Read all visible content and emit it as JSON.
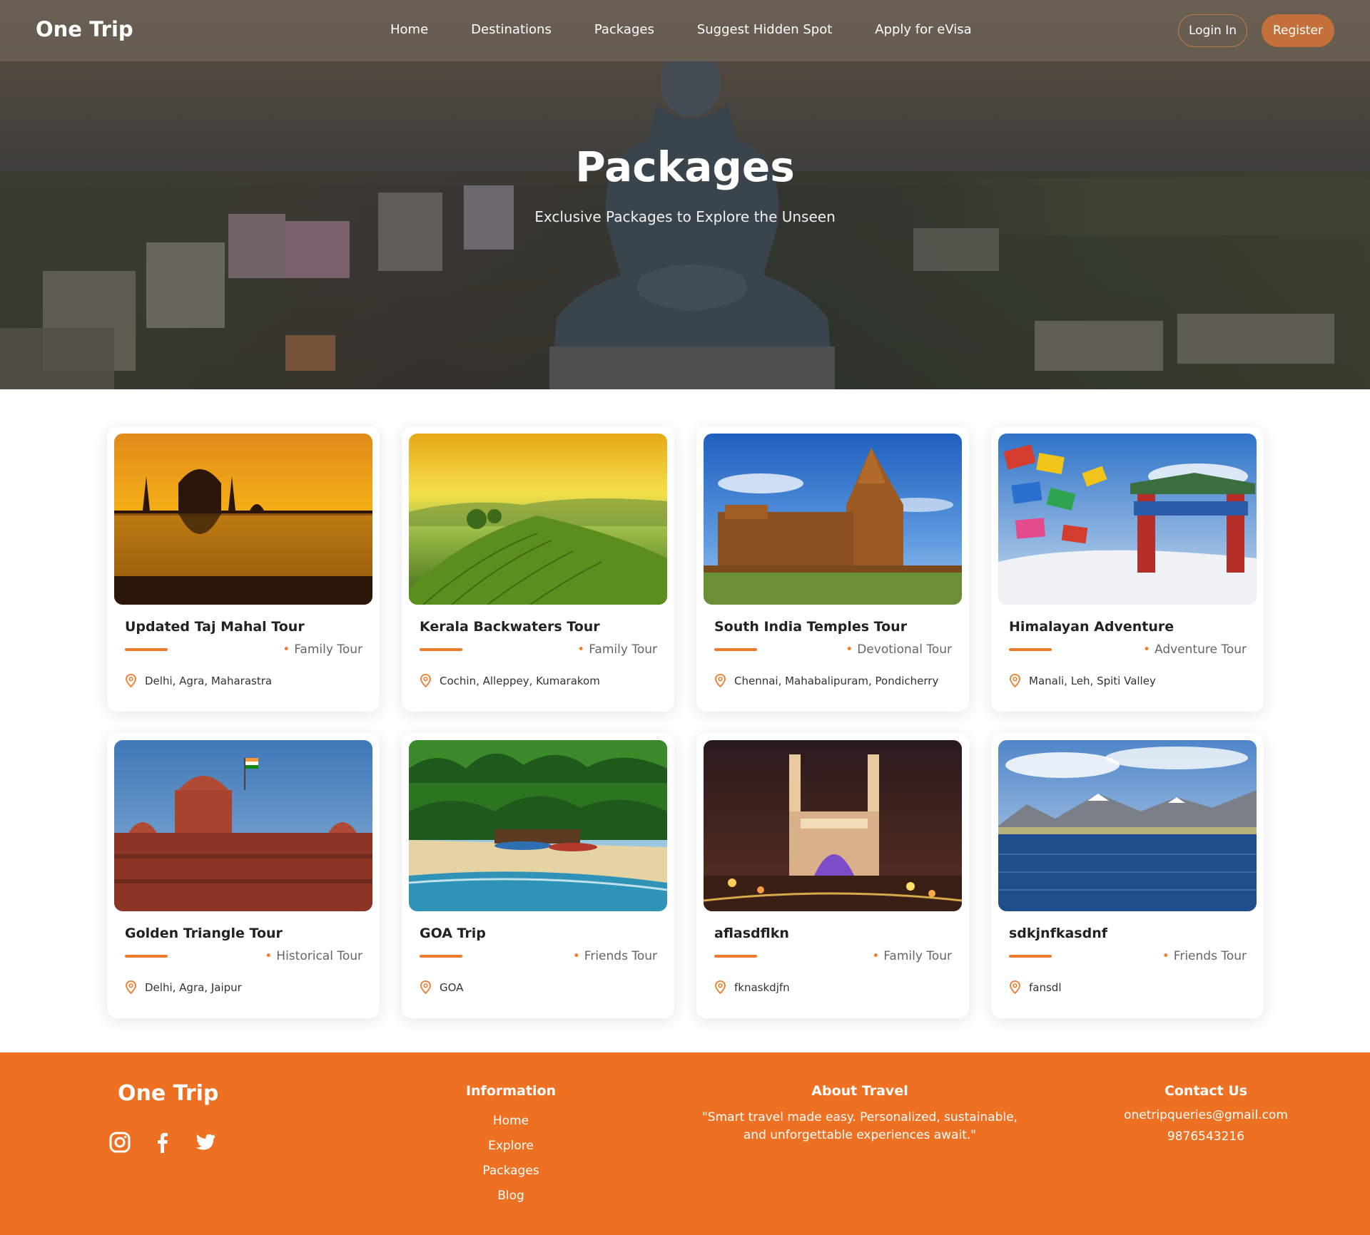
{
  "nav": {
    "logo": "One Trip",
    "links": [
      "Home",
      "Destinations",
      "Packages",
      "Suggest Hidden Spot",
      "Apply for eVisa"
    ],
    "login_label": "Login In",
    "register_label": "Register"
  },
  "hero": {
    "title": "Packages",
    "subtitle": "Exclusive Packages to Explore the Unseen"
  },
  "packages": [
    {
      "title": "Updated Taj Mahal Tour",
      "type": "Family Tour",
      "location": "Delhi, Agra, Maharastra",
      "image": "taj-mahal-sunset"
    },
    {
      "title": "Kerala Backwaters Tour",
      "type": "Family Tour",
      "location": "Cochin, Alleppey, Kumarakom",
      "image": "tea-plantation-hills"
    },
    {
      "title": "South India Temples Tour",
      "type": "Devotional Tour",
      "location": "Chennai, Mahabalipuram, Pondicherry",
      "image": "brihadeeswara-temple"
    },
    {
      "title": "Himalayan Adventure",
      "type": "Adventure Tour",
      "location": "Manali, Leh, Spiti Valley",
      "image": "prayer-flags-gate"
    },
    {
      "title": "Golden Triangle Tour",
      "type": "Historical Tour",
      "location": "Delhi, Agra, Jaipur",
      "image": "red-fort"
    },
    {
      "title": "GOA Trip",
      "type": "Friends Tour",
      "location": "GOA",
      "image": "palm-beach-boats"
    },
    {
      "title": "aflasdflkn",
      "type": "Family Tour",
      "location": "fknaskdjfn",
      "image": "charminar-night"
    },
    {
      "title": "sdkjnfkasdnf",
      "type": "Friends Tour",
      "location": "fansdl",
      "image": "mountain-lake"
    }
  ],
  "footer": {
    "logo": "One Trip",
    "social": [
      "instagram-icon",
      "facebook-icon",
      "twitter-icon"
    ],
    "info_heading": "Information",
    "info_links": [
      "Home",
      "Explore",
      "Packages",
      "Blog"
    ],
    "about_heading": "About Travel",
    "about_line1": "\"Smart travel made easy. Personalized, sustainable,",
    "about_line2": "and unforgettable experiences await.\"",
    "contact_heading": "Contact Us",
    "email": "onetripqueries@gmail.com",
    "phone": "9876543216"
  },
  "colors": {
    "accent": "#ef7b2a",
    "footer_bg": "#ee7022",
    "register_bg": "#c4703a"
  }
}
